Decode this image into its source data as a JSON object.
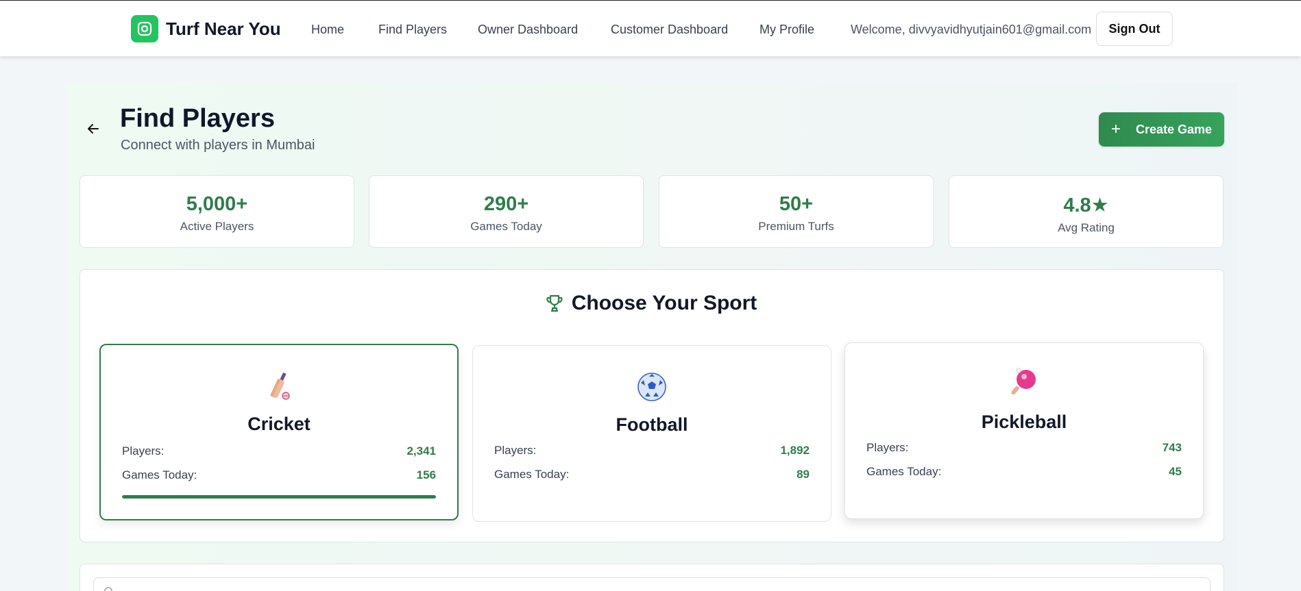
{
  "header": {
    "brand": "Turf Near You",
    "nav": [
      "Home",
      "Find Players",
      "Owner Dashboard",
      "Customer Dashboard",
      "My Profile"
    ],
    "welcome": "Welcome, divvyavidhyutjain601@gmail.com",
    "sign_out": "Sign Out"
  },
  "page": {
    "title": "Find Players",
    "subtitle": "Connect with players in Mumbai",
    "create_button": "Create Game"
  },
  "stats": [
    {
      "value": "5,000+",
      "label": "Active Players"
    },
    {
      "value": "290+",
      "label": "Games Today"
    },
    {
      "value": "50+",
      "label": "Premium Turfs"
    },
    {
      "value": "4.8★",
      "label": "Avg Rating"
    }
  ],
  "sports_section": {
    "heading": "Choose Your Sport",
    "players_label": "Players:",
    "games_label": "Games Today:",
    "sports": [
      {
        "name": "Cricket",
        "icon": "cricket-bat-icon",
        "players": "2,341",
        "games_today": "156",
        "selected": true,
        "progress": 1.0
      },
      {
        "name": "Football",
        "icon": "soccer-ball-icon",
        "players": "1,892",
        "games_today": "89",
        "selected": false
      },
      {
        "name": "Pickleball",
        "icon": "paddle-icon",
        "players": "743",
        "games_today": "45",
        "selected": false
      }
    ]
  },
  "search": {
    "placeholder": ""
  },
  "colors": {
    "accent": "#2e7d4a",
    "brand_logo": "#22c55e",
    "create_button": "#2f8a4e"
  }
}
